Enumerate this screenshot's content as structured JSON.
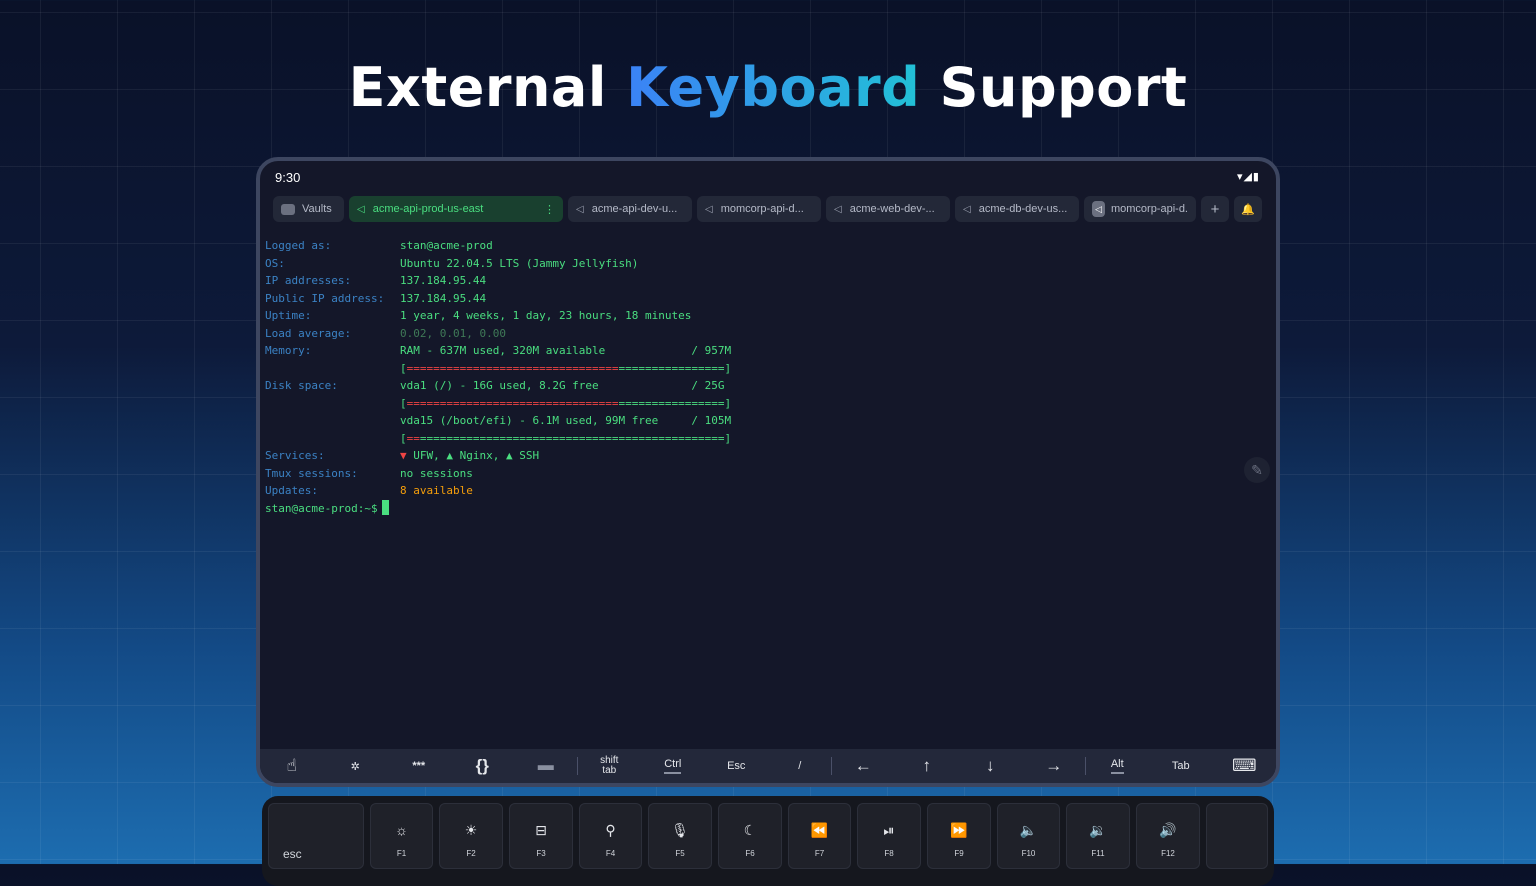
{
  "headline": {
    "pre": "External ",
    "highlight": "Keyboard",
    "post": " Support"
  },
  "status": {
    "time": "9:30",
    "icons": "▾◢▮"
  },
  "tabs": {
    "vaults": "Vaults",
    "active": "acme-api-prod-us-east",
    "active_menu": "⋮",
    "items": [
      "acme-api-dev-u...",
      "momcorp-api-d...",
      "acme-web-dev-...",
      "acme-db-dev-us...",
      "momcorp-api-d."
    ],
    "add": "+",
    "bell": "🔔",
    "host_icon": "◁"
  },
  "terminal": {
    "logged_as_label": "Logged as:",
    "logged_as": "stan@acme-prod",
    "os_label": "OS:",
    "os": "Ubuntu 22.04.5 LTS (Jammy Jellyfish)",
    "ip_label": "IP addresses:",
    "ip": "137.184.95.44",
    "pub_ip_label": "Public IP address:",
    "pub_ip": "137.184.95.44",
    "uptime_label": "Uptime:",
    "uptime": "1 year, 4 weeks, 1 day, 23 hours, 18 minutes",
    "load_label": "Load average:",
    "load": "0.02, 0.01, 0.00",
    "memory_label": "Memory:",
    "memory": "RAM - 637M used, 320M available             / 957M",
    "memory_bar_open": "[",
    "memory_bar_used": "================================",
    "memory_bar_free": "================",
    "memory_bar_close": "]",
    "memory_used_fraction": 0.67,
    "disk_label": "Disk space:",
    "disk1": "vda1 (/) - 16G used, 8.2G free              / 25G",
    "disk1_bar_open": "[",
    "disk1_bar_used": "================================",
    "disk1_bar_free": "================",
    "disk1_bar_close": "]",
    "disk1_used_fraction": 0.64,
    "disk2": "vda15 (/boot/efi) - 6.1M used, 99M free     / 105M",
    "disk2_bar_open": "[",
    "disk2_bar_used": "==",
    "disk2_bar_free": "==============================================",
    "disk2_bar_close": "]",
    "disk2_used_fraction": 0.06,
    "services_label": "Services:",
    "svc_down_mark": "▼",
    "svc1": " UFW, ",
    "svc_up_mark": "▲",
    "svc2": " Nginx, ",
    "svc3": " SSH",
    "tmux_label": "Tmux sessions:",
    "tmux": "no sessions",
    "updates_label": "Updates:",
    "updates": "8 available",
    "prompt": "stan@acme-prod:~$"
  },
  "toolbar": {
    "hand": "☝",
    "magic": "✲",
    "password": "***",
    "snippets": "{}",
    "folder": "▬",
    "shift_tab_1": "shift",
    "shift_tab_2": "tab",
    "ctrl": "Ctrl",
    "esc": "Esc",
    "slash": "/",
    "left": "←",
    "up": "↑",
    "down": "↓",
    "right": "→",
    "alt": "Alt",
    "tab": "Tab",
    "keyboard": "⌨"
  },
  "keys": [
    {
      "icon": "",
      "label": "esc"
    },
    {
      "icon": "☼",
      "label": "F1"
    },
    {
      "icon": "☀",
      "label": "F2"
    },
    {
      "icon": "⊟",
      "label": "F3"
    },
    {
      "icon": "⚲",
      "label": "F4"
    },
    {
      "icon": "🎙",
      "label": "F5"
    },
    {
      "icon": "☾",
      "label": "F6"
    },
    {
      "icon": "⏪",
      "label": "F7"
    },
    {
      "icon": "⏯",
      "label": "F8"
    },
    {
      "icon": "⏩",
      "label": "F9"
    },
    {
      "icon": "🔈",
      "label": "F10"
    },
    {
      "icon": "🔉",
      "label": "F11"
    },
    {
      "icon": "🔊",
      "label": "F12"
    },
    {
      "icon": "",
      "label": ""
    }
  ]
}
